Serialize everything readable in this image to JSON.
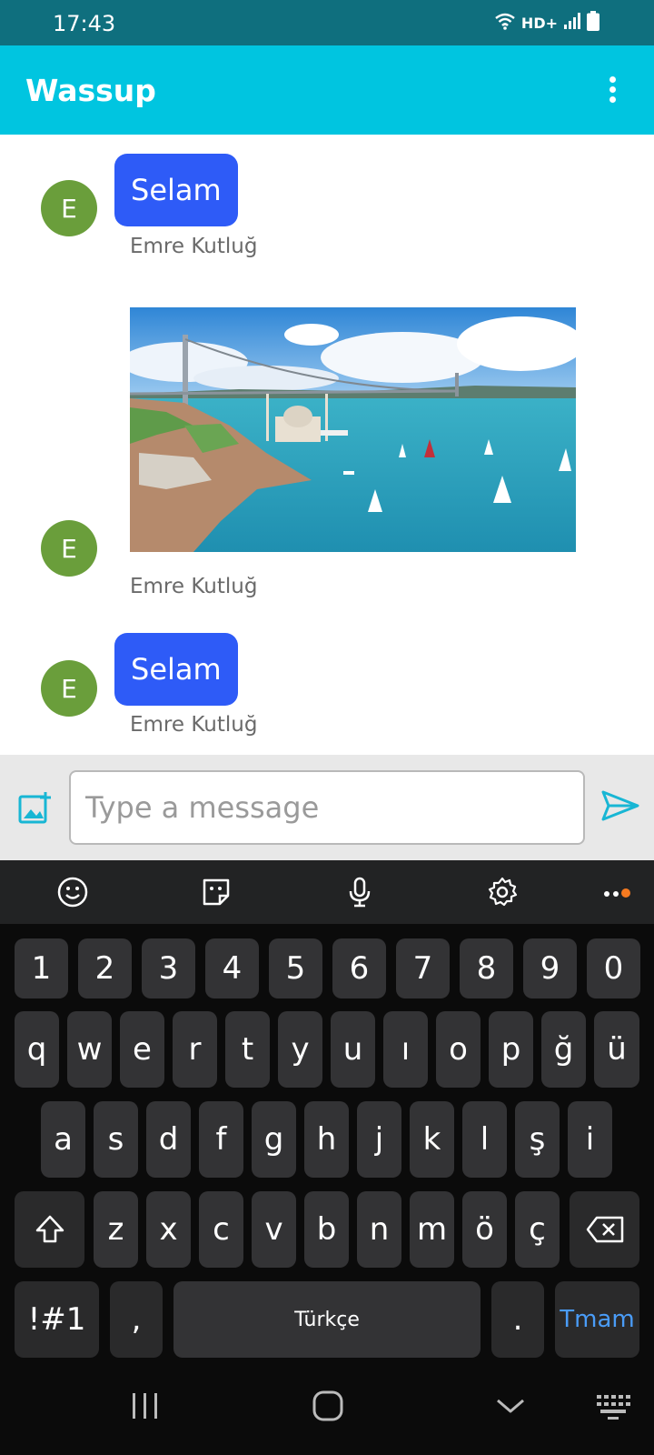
{
  "status_bar": {
    "time": "17:43",
    "network_label": "HD+",
    "icons": [
      "wifi-icon",
      "signal-icon",
      "battery-icon"
    ]
  },
  "app_bar": {
    "title": "Wassup",
    "menu_icon": "more-vert-icon",
    "background_color": "#00c5e0"
  },
  "messages": [
    {
      "type": "text",
      "avatar_initial": "E",
      "text": "Selam",
      "sender": "Emre Kutluğ"
    },
    {
      "type": "image",
      "avatar_initial": "E",
      "image_desc": "Bosphorus strait photo with bridge, mosque and sailboats",
      "sender": "Emre Kutluğ"
    },
    {
      "type": "text",
      "avatar_initial": "E",
      "text": "Selam",
      "sender": "Emre Kutluğ"
    }
  ],
  "composer": {
    "placeholder": "Type a message",
    "value": "",
    "attach_icon": "add-photo-icon",
    "send_icon": "send-icon"
  },
  "keyboard": {
    "toolbar": [
      "emoji-icon",
      "sticker-icon",
      "mic-icon",
      "settings-icon",
      "more-horiz-icon"
    ],
    "row_numbers": [
      "1",
      "2",
      "3",
      "4",
      "5",
      "6",
      "7",
      "8",
      "9",
      "0"
    ],
    "row_1": [
      "q",
      "w",
      "e",
      "r",
      "t",
      "y",
      "u",
      "ı",
      "o",
      "p",
      "ğ",
      "ü"
    ],
    "row_2": [
      "a",
      "s",
      "d",
      "f",
      "g",
      "h",
      "j",
      "k",
      "l",
      "ş",
      "i"
    ],
    "row_3": [
      "z",
      "x",
      "c",
      "v",
      "b",
      "n",
      "m",
      "ö",
      "ç"
    ],
    "symbols_key": "!#1",
    "comma_key": ",",
    "space_label": "Türkçe",
    "period_key": ".",
    "done_label": "Tmam"
  },
  "nav_bar": {
    "icons": [
      "recents-icon",
      "home-icon",
      "back-icon",
      "keyboard-switch-icon"
    ]
  }
}
